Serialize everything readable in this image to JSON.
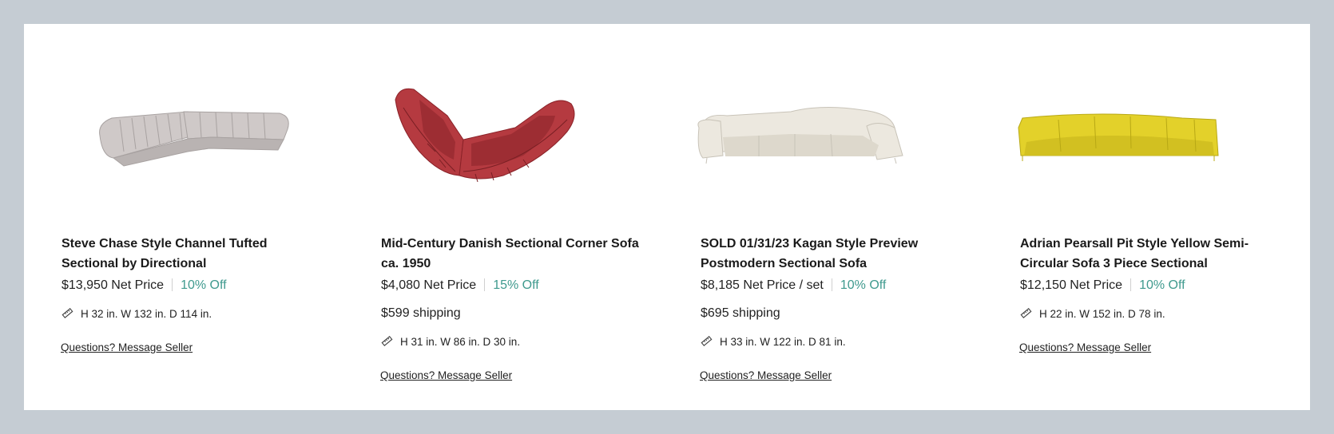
{
  "listings": [
    {
      "title": "Steve Chase Style Channel Tufted Sectional by Directional",
      "price": "$13,950 Net Price",
      "discount": "10% Off",
      "shipping": "",
      "dimensions": "H 32 in. W 132 in. D 114 in.",
      "message_link": "Questions? Message Seller",
      "image_color": "#cfc9c8"
    },
    {
      "title": "Mid-Century Danish Sectional Corner Sofa ca. 1950",
      "price": "$4,080 Net Price",
      "discount": "15% Off",
      "shipping": "$599 shipping",
      "dimensions": "H 31 in. W 86 in. D 30 in.",
      "message_link": "Questions? Message Seller",
      "image_color": "#b53a40"
    },
    {
      "title": "SOLD 01/31/23 Kagan Style Preview Postmodern Sectional Sofa",
      "price": "$8,185 Net Price / set",
      "discount": "10% Off",
      "shipping": "$695 shipping",
      "dimensions": "H 33 in. W 122 in. D 81 in.",
      "message_link": "Questions? Message Seller",
      "image_color": "#ece8df"
    },
    {
      "title": "Adrian Pearsall Pit Style Yellow Semi-Circular Sofa 3 Piece Sectional",
      "price": "$12,150 Net Price",
      "discount": "10% Off",
      "shipping": "",
      "dimensions": "H 22 in. W 152 in. D 78 in.",
      "message_link": "Questions? Message Seller",
      "image_color": "#e3d12a"
    }
  ],
  "icons": {
    "dimensions": "ruler-icon"
  },
  "colors": {
    "discount": "#3f9a8e",
    "backdrop": "#c5ccd3"
  }
}
